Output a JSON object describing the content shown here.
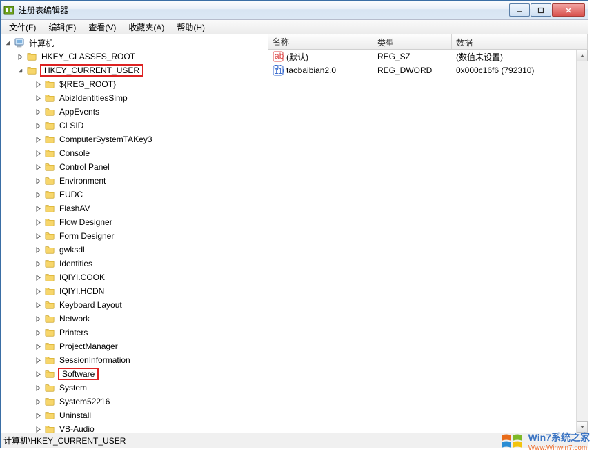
{
  "window": {
    "title": "注册表编辑器"
  },
  "menu": {
    "file": "文件(F)",
    "edit": "编辑(E)",
    "view": "查看(V)",
    "favorites": "收藏夹(A)",
    "help": "帮助(H)"
  },
  "tree": {
    "root": "计算机",
    "hkcr": "HKEY_CLASSES_ROOT",
    "hkcu": "HKEY_CURRENT_USER",
    "children": [
      "${REG_ROOT}",
      "AbizIdentitiesSimp",
      "AppEvents",
      "CLSID",
      "ComputerSystemTAKey3",
      "Console",
      "Control Panel",
      "Environment",
      "EUDC",
      "FlashAV",
      "Flow Designer",
      "Form Designer",
      "gwksdl",
      "Identities",
      "IQIYI.COOK",
      "IQIYI.HCDN",
      "Keyboard Layout",
      "Network",
      "Printers",
      "ProjectManager",
      "SessionInformation",
      "Software",
      "System",
      "System52216",
      "Uninstall",
      "VB-Audio"
    ],
    "highlighted": [
      "HKEY_CURRENT_USER",
      "Software"
    ]
  },
  "list": {
    "headers": {
      "name": "名称",
      "type": "类型",
      "data": "数据"
    },
    "rows": [
      {
        "icon": "string",
        "name": "(默认)",
        "type": "REG_SZ",
        "data": "(数值未设置)"
      },
      {
        "icon": "binary",
        "name": "taobaibian2.0",
        "type": "REG_DWORD",
        "data": "0x000c16f6 (792310)"
      }
    ]
  },
  "statusbar": {
    "path": "计算机\\HKEY_CURRENT_USER"
  },
  "watermark": {
    "main": "Win7系统之家",
    "sub": "Www.Winwin7.com"
  }
}
